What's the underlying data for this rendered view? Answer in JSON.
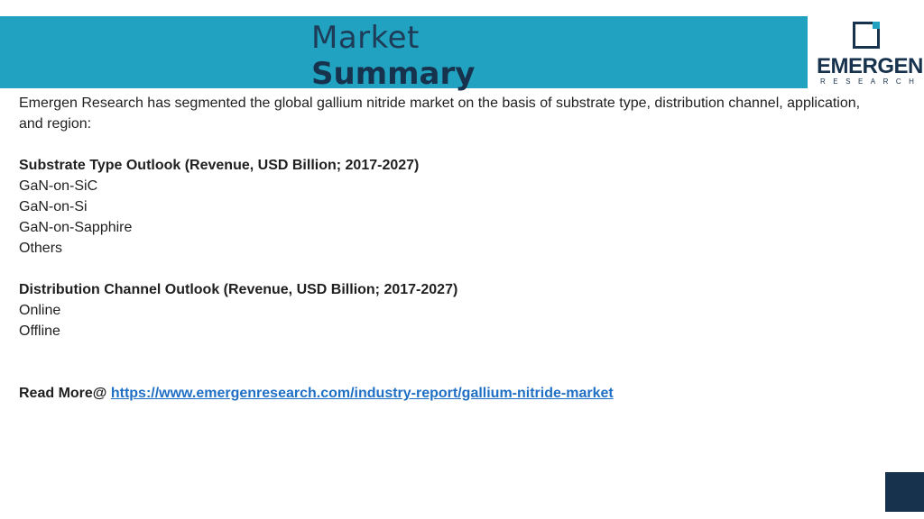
{
  "header": {
    "title_line1": "Market",
    "title_line2": "Summary",
    "colors": {
      "banner": "#21a2c0",
      "navy": "#17324d"
    }
  },
  "logo": {
    "name": "EMERGEN",
    "sub": "RESEARCH"
  },
  "content": {
    "intro": "Emergen Research has segmented the global gallium nitride market on the basis of substrate type, distribution channel, application, and region:",
    "sections": [
      {
        "heading": "Substrate Type Outlook (Revenue, USD Billion; 2017-2027)",
        "items": [
          "GaN-on-SiC",
          "GaN-on-Si",
          "GaN-on-Sapphire",
          "Others"
        ]
      },
      {
        "heading": "Distribution Channel Outlook (Revenue, USD Billion; 2017-2027)",
        "items": [
          "Online",
          "Offline"
        ]
      }
    ],
    "read_more_label": "Read More@ ",
    "read_more_url": "https://www.emergenresearch.com/industry-report/gallium-nitride-market"
  }
}
